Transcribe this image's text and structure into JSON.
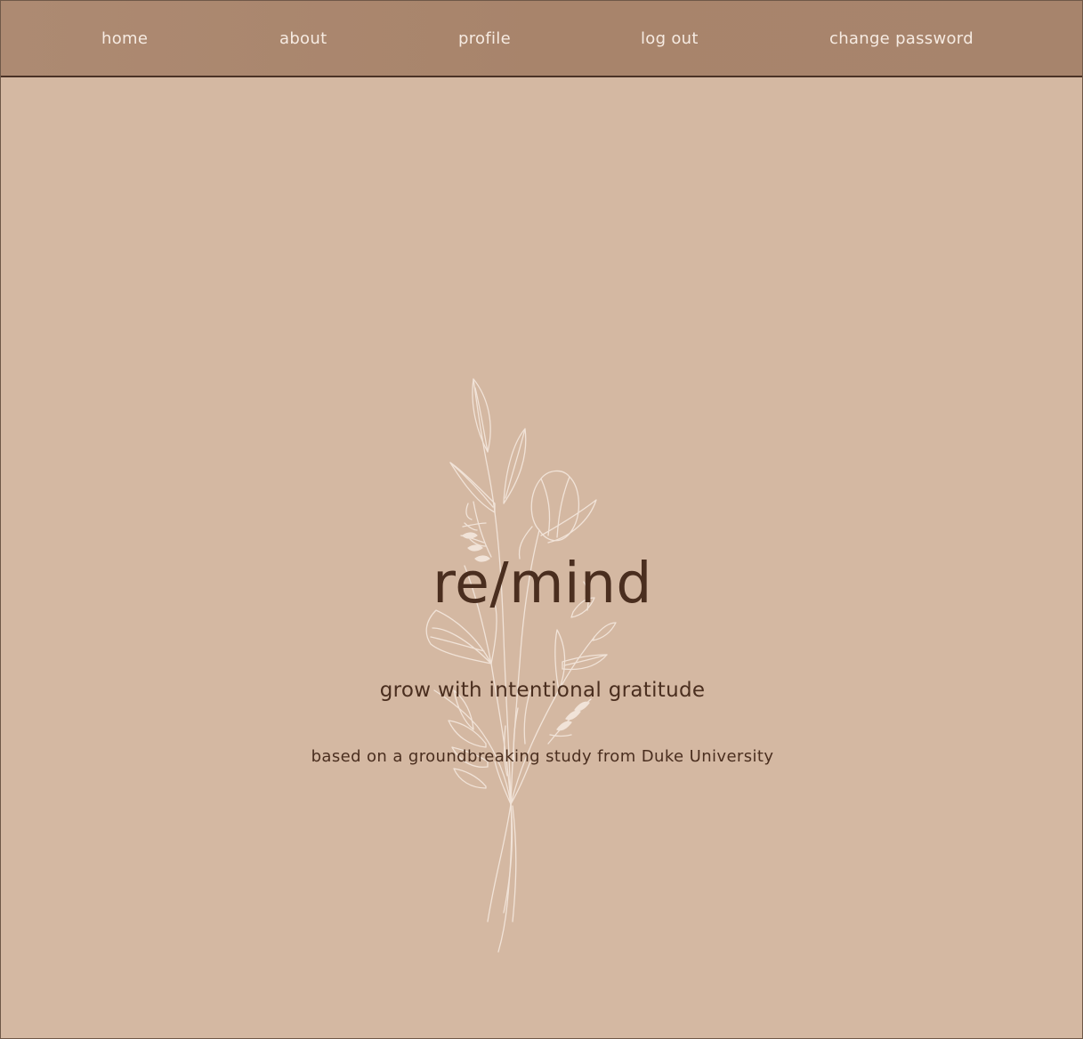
{
  "nav": {
    "home": "home",
    "about": "about",
    "profile": "profile",
    "logout": "log out",
    "change_password": "change password"
  },
  "hero": {
    "title": "re/mind",
    "tagline": "grow with intentional gratitude",
    "subtext": "based on a groundbreaking study from Duke University"
  },
  "colors": {
    "background": "#d4b8a2",
    "nav_background": "#a9866d",
    "nav_text": "#f6ebe2",
    "heading_text": "#4a2e1f",
    "illustration_stroke": "#f1e3d8"
  },
  "decoration": {
    "icon": "floral-bouquet-illustration"
  }
}
